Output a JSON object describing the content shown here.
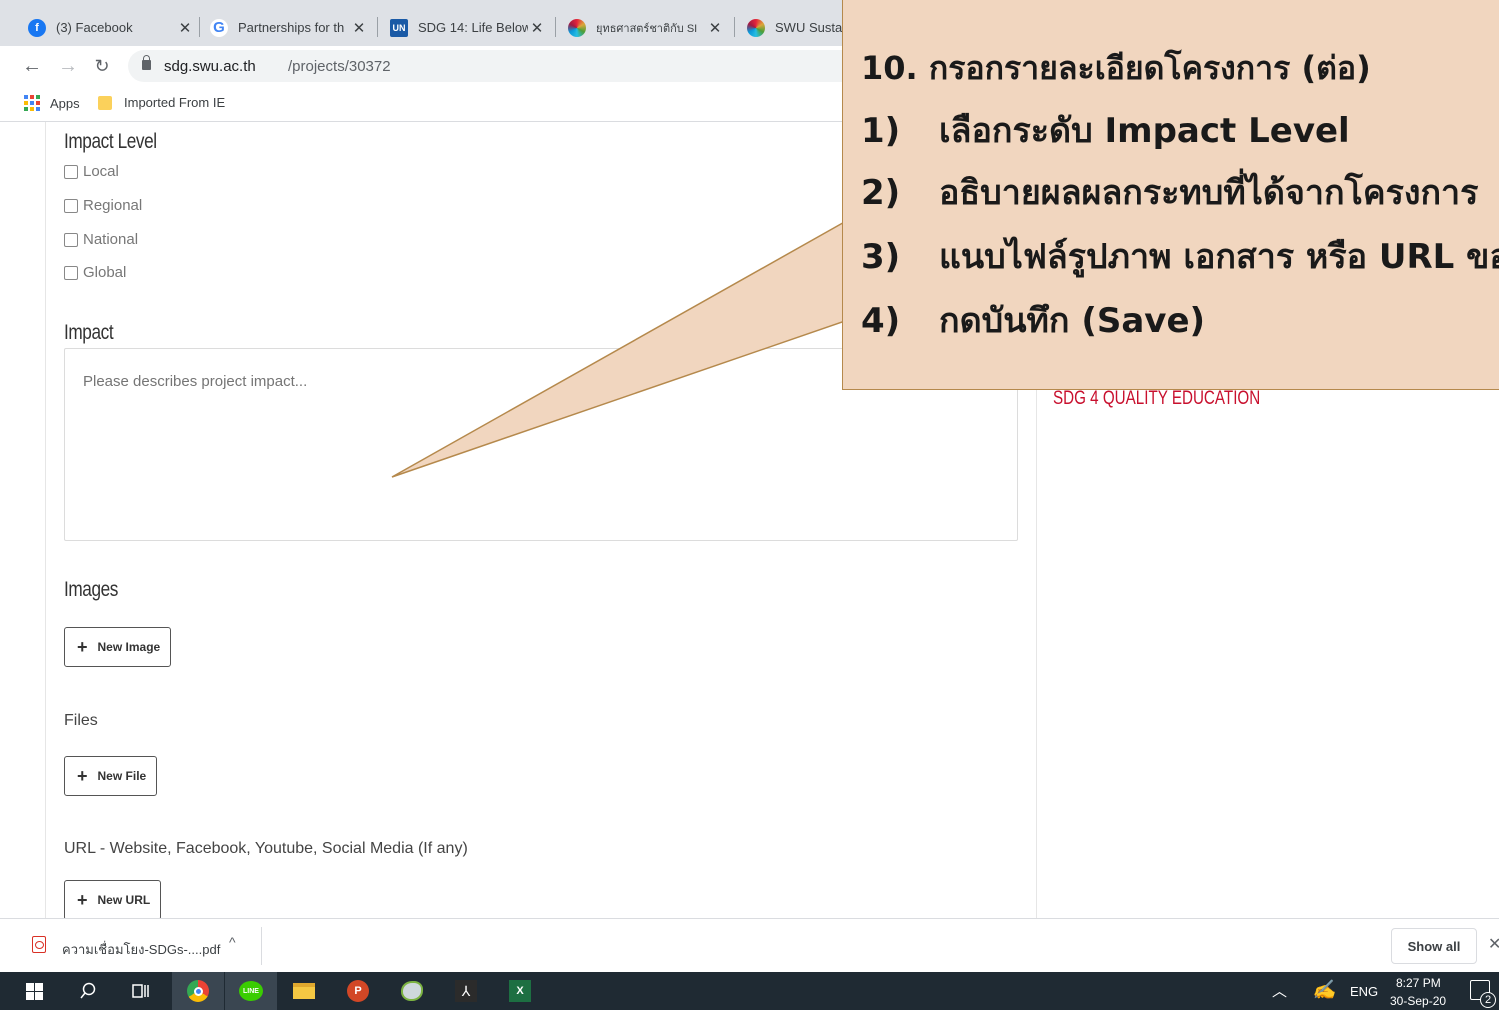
{
  "browser": {
    "tabs": [
      {
        "favicon": "facebook-icon",
        "label": "(3) Facebook"
      },
      {
        "favicon": "google-icon",
        "label": "Partnerships for th"
      },
      {
        "favicon": "un-icon",
        "label": "SDG 14: Life Below"
      },
      {
        "favicon": "sdg-wheel-icon",
        "label": "ยุทธศาสตร์ชาติกับ SI"
      },
      {
        "favicon": "sdg-wheel-icon",
        "label": "SWU Sustai"
      }
    ],
    "address": {
      "domain": "sdg.swu.ac.th",
      "path": "/projects/30372"
    },
    "bookmarks": {
      "apps_label": "Apps",
      "folder_label": "Imported From IE"
    }
  },
  "form": {
    "impact_level": {
      "heading": "Impact Level",
      "options": [
        "Local",
        "Regional",
        "National",
        "Global"
      ]
    },
    "impact": {
      "heading": "Impact",
      "placeholder": "Please describes project impact..."
    },
    "images": {
      "heading": "Images",
      "button": "New Image"
    },
    "files": {
      "heading": "Files",
      "button": "New File"
    },
    "url": {
      "heading": "URL - Website, Facebook, Youtube, Social Media (If any)",
      "button": "New URL"
    }
  },
  "sidebar": {
    "sdg_tag": "SDG 4 QUALITY EDUCATION"
  },
  "callout": {
    "title": "10. กรอกรายละเอียดโครงการ (ต่อ)",
    "items": [
      {
        "num": "1)",
        "text": "เลือกระดับ Impact Level"
      },
      {
        "num": "2)",
        "text": "อธิบายผลผลกระทบที่ได้จากโครงการ"
      },
      {
        "num": "3)",
        "text": "แนบไฟล์รูปภาพ เอกสาร หรือ URL ของ"
      },
      {
        "num": "4)",
        "text": "กดบันทึก (Save)"
      }
    ]
  },
  "downloads": {
    "filename": "ความเชื่อมโยง-SDGs-....pdf",
    "show_all": "Show all"
  },
  "taskbar": {
    "language": "ENG",
    "time": "8:27 PM",
    "date": "30-Sep-20",
    "notification_count": "2"
  },
  "colors": {
    "callout_bg": "#f1d6bf",
    "callout_border": "#b5894c",
    "sdg_red": "#c8102e",
    "taskbar_bg": "#1f2a33"
  }
}
